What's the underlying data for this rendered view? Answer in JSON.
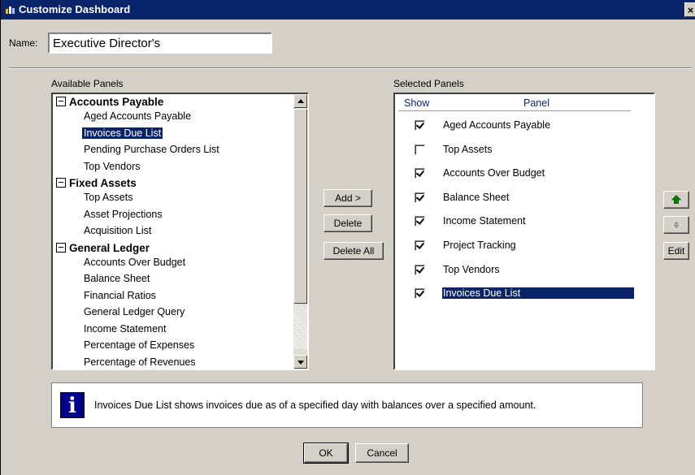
{
  "window": {
    "title": "Customize Dashboard",
    "close_label": "×"
  },
  "name_field": {
    "label": "Name:",
    "value": "Executive Director's"
  },
  "available": {
    "label": "Available Panels",
    "groups": [
      {
        "name": "Accounts Payable",
        "items": [
          "Aged Accounts Payable",
          "Invoices Due List",
          "Pending Purchase Orders List",
          "Top Vendors"
        ]
      },
      {
        "name": "Fixed Assets",
        "items": [
          "Top Assets",
          "Asset Projections",
          "Acquisition List"
        ]
      },
      {
        "name": "General Ledger",
        "items": [
          "Accounts Over Budget",
          "Balance Sheet",
          "Financial Ratios",
          "General Ledger Query",
          "Income Statement",
          "Percentage of Expenses",
          "Percentage of Revenues"
        ]
      }
    ],
    "selected_item": "Invoices Due List"
  },
  "buttons": {
    "add": "Add >",
    "delete": "Delete",
    "delete_all": "Delete All",
    "edit": "Edit",
    "ok": "OK",
    "cancel": "Cancel"
  },
  "selected": {
    "label": "Selected Panels",
    "col_show": "Show",
    "col_panel": "Panel",
    "rows": [
      {
        "label": "Aged Accounts Payable",
        "checked": true
      },
      {
        "label": "Top Assets",
        "checked": false
      },
      {
        "label": "Accounts Over Budget",
        "checked": true
      },
      {
        "label": "Balance Sheet",
        "checked": true
      },
      {
        "label": "Income Statement",
        "checked": true
      },
      {
        "label": "Project Tracking",
        "checked": true
      },
      {
        "label": "Top Vendors",
        "checked": true
      },
      {
        "label": "Invoices Due List",
        "checked": true,
        "selected": true
      }
    ]
  },
  "info": {
    "icon": "info-icon",
    "text": "Invoices Due List shows invoices due as of a specified day with balances over a specified amount."
  },
  "colors": {
    "titlebar": "#0a246a",
    "selection": "#0a246a",
    "move_up_arrow": "#008000"
  }
}
